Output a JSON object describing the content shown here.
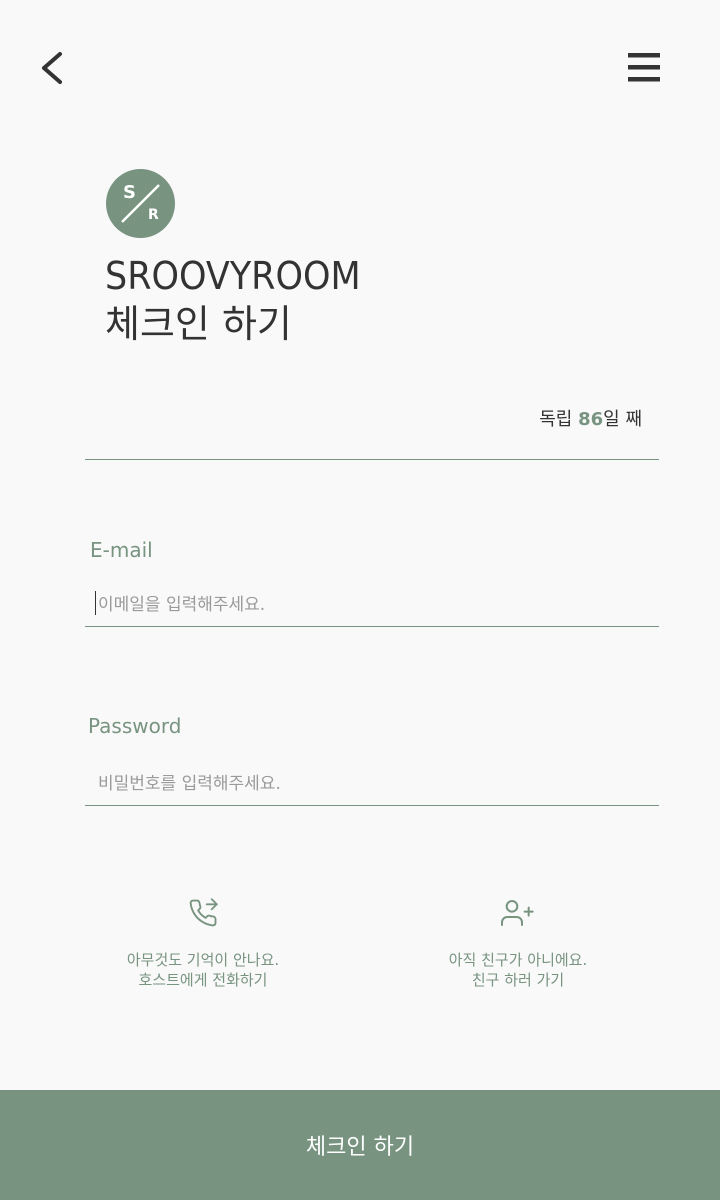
{
  "header": {
    "back_icon": "chevron-left-icon",
    "menu_icon": "hamburger-menu-icon"
  },
  "logo": {
    "letter_top": "S",
    "letter_bottom": "R",
    "color": "#789481"
  },
  "title": {
    "line1": "SROOVYROOM",
    "line2": "체크인 하기"
  },
  "day_count": {
    "prefix": "독립 ",
    "number": "86",
    "suffix": "일 째"
  },
  "email": {
    "label": "E-mail",
    "placeholder": "이메일을 입력해주세요.",
    "value": ""
  },
  "password": {
    "label": "Password",
    "placeholder": "비밀번호를 입력해주세요.",
    "value": ""
  },
  "helpers": {
    "call_host": {
      "icon": "phone-forward-icon",
      "line1": "아무것도 기억이 안나요.",
      "line2": "호스트에게 전화하기"
    },
    "add_friend": {
      "icon": "user-plus-icon",
      "line1": "아직 친구가 아니에요.",
      "line2": "친구 하러 가기"
    }
  },
  "submit": {
    "label": "체크인 하기"
  },
  "colors": {
    "accent": "#789481",
    "background": "#f9f9f9",
    "text": "#333333"
  }
}
